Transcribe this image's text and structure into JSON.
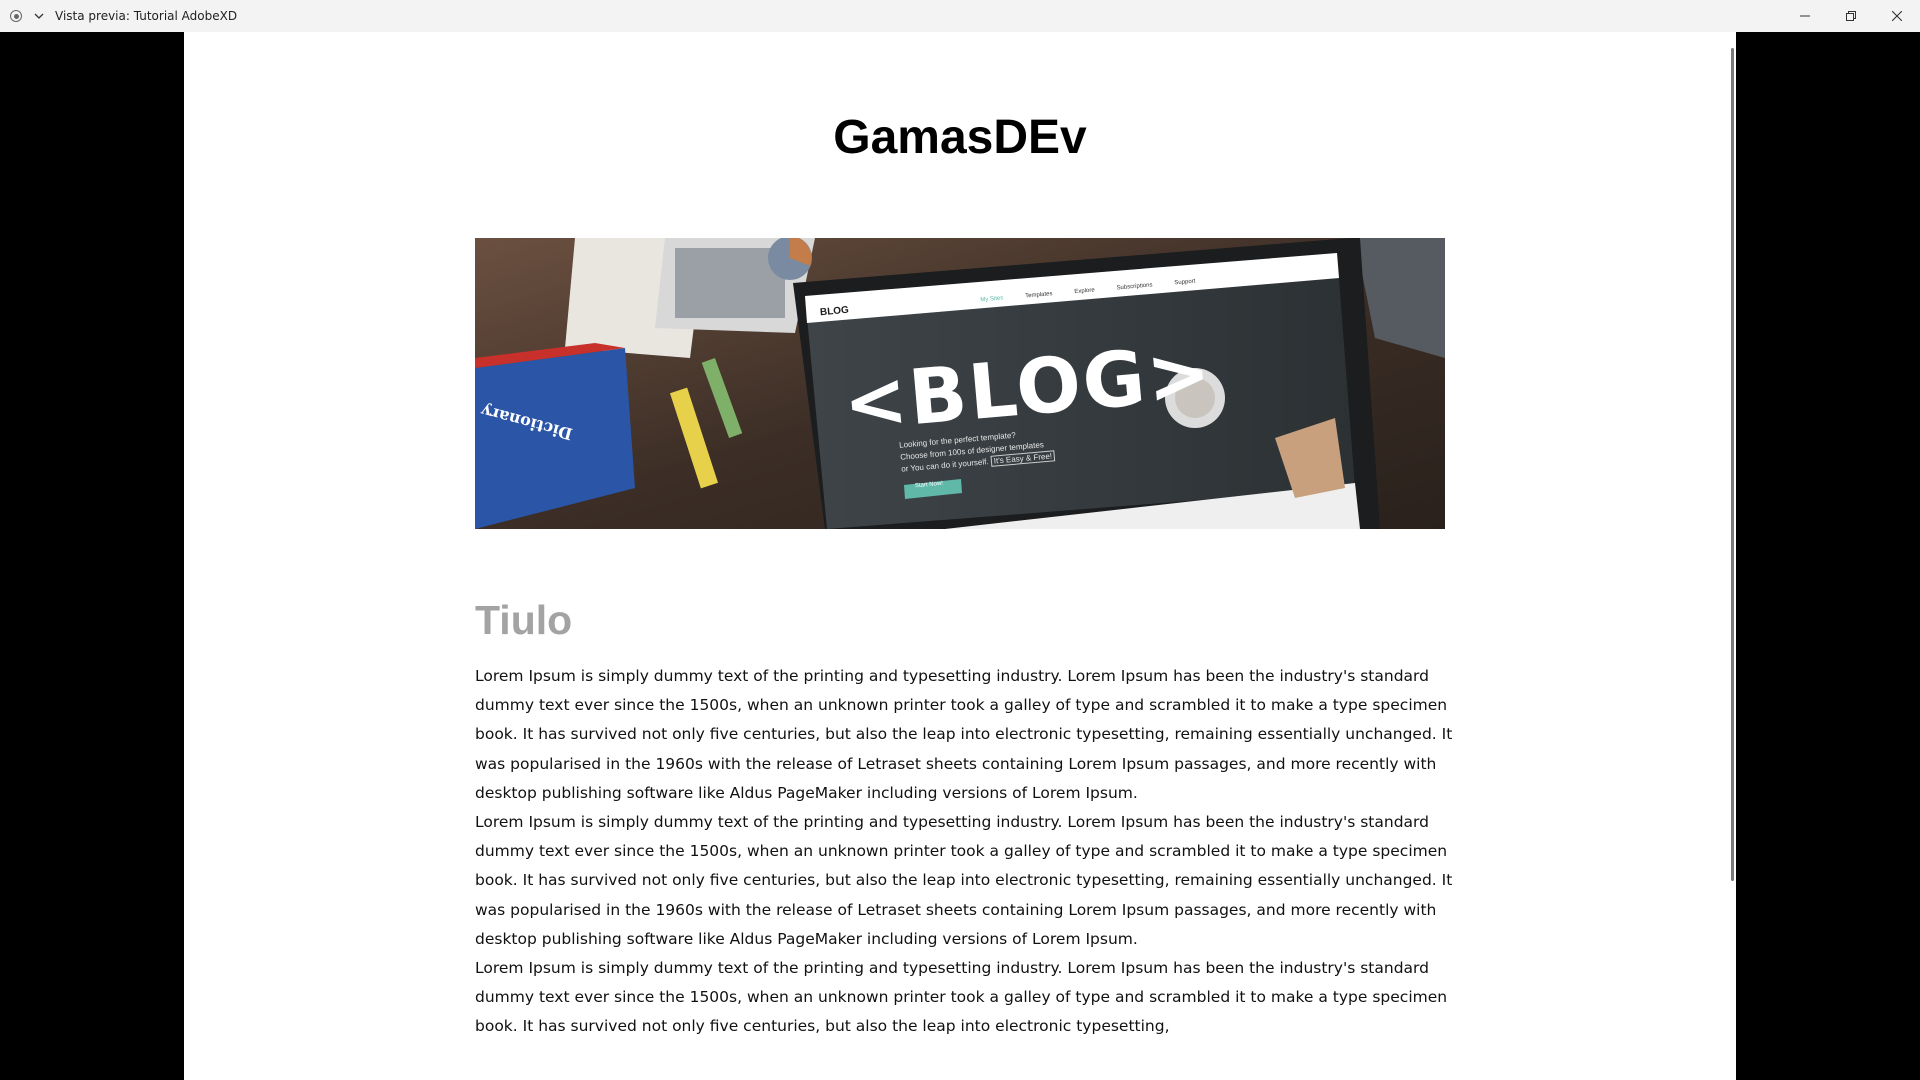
{
  "window": {
    "title": "Vista previa: Tutorial AdobeXD",
    "icons": {
      "record": "record-icon",
      "menu": "chevron-down-icon",
      "minimize": "minimize-icon",
      "restore": "restore-icon",
      "close": "close-icon"
    }
  },
  "page": {
    "site_title": "GamasDEv",
    "hero": {
      "screen_nav": [
        "My Sites",
        "Templates",
        "Explore",
        "Subscriptions",
        "Support"
      ],
      "screen_logo": "BLOG",
      "headline": "<BLOG>",
      "tagline_1": "Looking for the perfect template?",
      "tagline_2": "Choose from 100s of designer templates",
      "tagline_3": "or You can do it yourself.",
      "tagline_badge": "It's Easy & Free!",
      "cta": "Start Now!",
      "book_label": "Dictionary"
    },
    "post_title": "Tiulo",
    "paragraphs": [
      "Lorem Ipsum is simply dummy text of the printing and typesetting industry. Lorem Ipsum has been the industry's standard dummy text ever since the 1500s, when an unknown printer took a galley of type and scrambled it to make a type specimen book. It has survived not only five centuries, but also the leap into electronic typesetting, remaining essentially unchanged. It was popularised in the 1960s with the release of Letraset sheets containing Lorem Ipsum passages, and more recently with desktop publishing software like Aldus PageMaker including versions of Lorem Ipsum.",
      "Lorem Ipsum is simply dummy text of the printing and typesetting industry. Lorem Ipsum has been the industry's standard dummy text ever since the 1500s, when an unknown printer took a galley of type and scrambled it to make a type specimen book. It has survived not only five centuries, but also the leap into electronic typesetting, remaining essentially unchanged. It was popularised in the 1960s with the release of Letraset sheets containing Lorem Ipsum passages, and more recently with desktop publishing software like Aldus PageMaker including versions of Lorem Ipsum.",
      "Lorem Ipsum is simply dummy text of the printing and typesetting industry. Lorem Ipsum has been the industry's standard dummy text ever since the 1500s, when an unknown printer took a galley of type and scrambled it to make a type specimen book. It has survived not only five centuries, but also the leap into electronic typesetting,"
    ]
  },
  "colors": {
    "background": "#000000",
    "page": "#ffffff",
    "titlebar": "#f3f3f3",
    "post_title": "#a3a3a3",
    "cta": "#5fb8a8"
  }
}
